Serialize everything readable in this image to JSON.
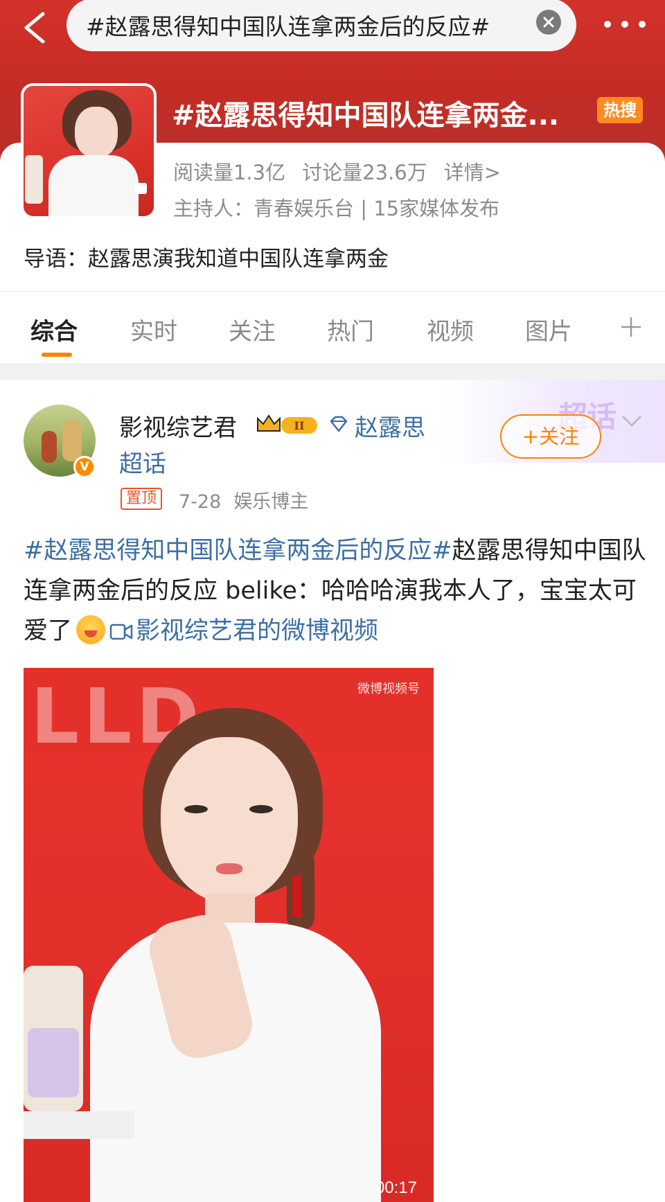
{
  "header": {
    "search_query": "#赵露思得知中国队连拿两金后的反应#",
    "topic_title": "#赵露思得知中国队连拿两金...",
    "hot_badge": "热搜"
  },
  "topic": {
    "read_count": "阅读量1.3亿",
    "discussion_count": "讨论量23.6万",
    "details_link": "详情>",
    "host": "主持人：青春娱乐台 | 15家媒体发布",
    "intro": "导语：赵露思演我知道中国队连拿两金"
  },
  "tabs": [
    {
      "label": "综合",
      "active": true
    },
    {
      "label": "实时",
      "active": false
    },
    {
      "label": "关注",
      "active": false
    },
    {
      "label": "热门",
      "active": false
    },
    {
      "label": "视频",
      "active": false
    },
    {
      "label": "图片",
      "active": false
    }
  ],
  "post": {
    "author": "影视综艺君",
    "level_badge": "II",
    "super_topic_line1": "赵露思",
    "super_topic_line2": "超话",
    "follow_label": "+关注",
    "pin_label": "置顶",
    "date": "7-28",
    "author_role": "娱乐博主",
    "hashtag": "#赵露思得知中国队连拿两金后的反应#",
    "body": "赵露思得知中国队连拿两金后的反应 belike：哈哈哈演我本人了，宝宝太可爱了",
    "video_link": "影视综艺君的微博视频",
    "video_duration": "00:17",
    "video_watermark": "微博视频号",
    "deco_text": "超话"
  },
  "colors": {
    "header_red": "#c42c25",
    "accent_orange": "#ff8200",
    "link_blue": "#3d6fa4"
  }
}
